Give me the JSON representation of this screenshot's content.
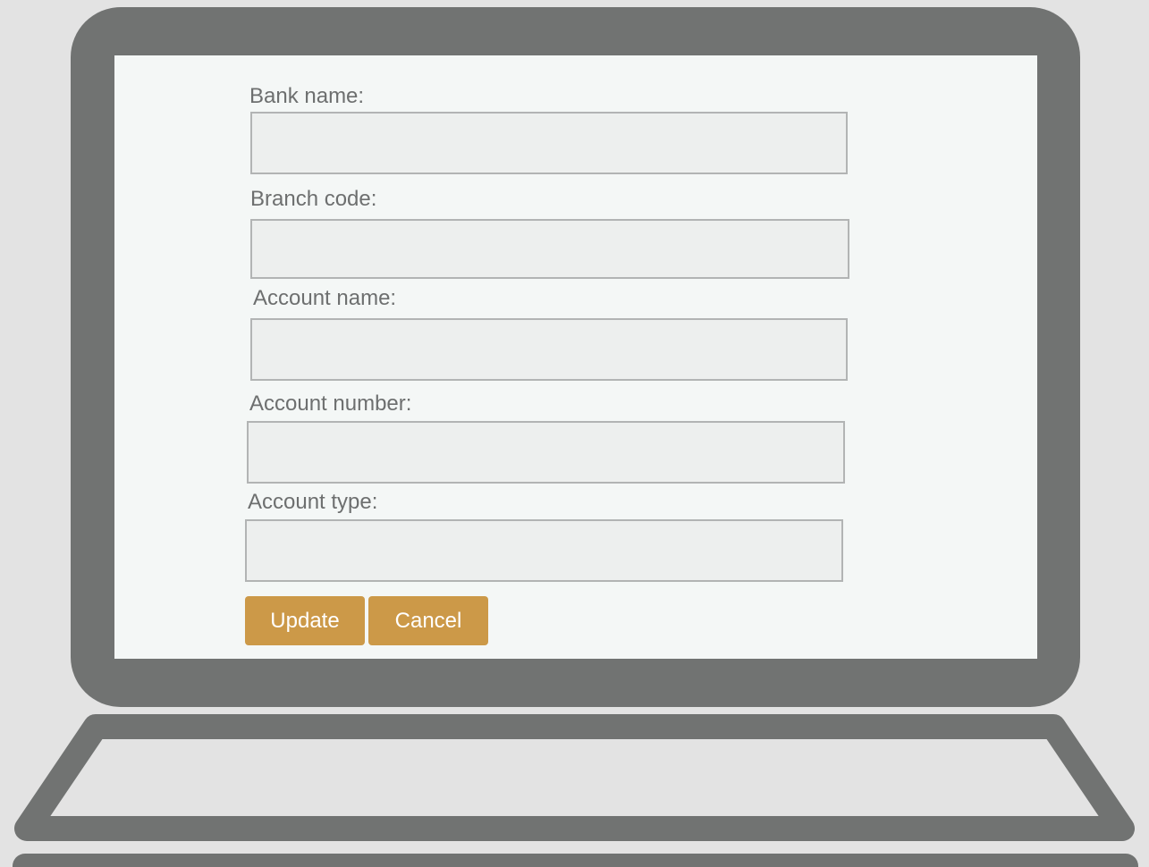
{
  "form": {
    "fields": [
      {
        "label": "Bank name:",
        "value": ""
      },
      {
        "label": "Branch code:",
        "value": ""
      },
      {
        "label": "Account name:",
        "value": ""
      },
      {
        "label": "Account number:",
        "value": ""
      },
      {
        "label": "Account type:",
        "value": ""
      }
    ],
    "buttons": {
      "update_label": "Update",
      "cancel_label": "Cancel"
    }
  },
  "colors": {
    "device_frame": "#717372",
    "screen_background": "#f4f7f6",
    "input_background": "#edefee",
    "input_border": "#b2b4b4",
    "button_accent": "#cc9948",
    "label_text": "#6d6f6f",
    "page_background": "#e3e3e3"
  }
}
